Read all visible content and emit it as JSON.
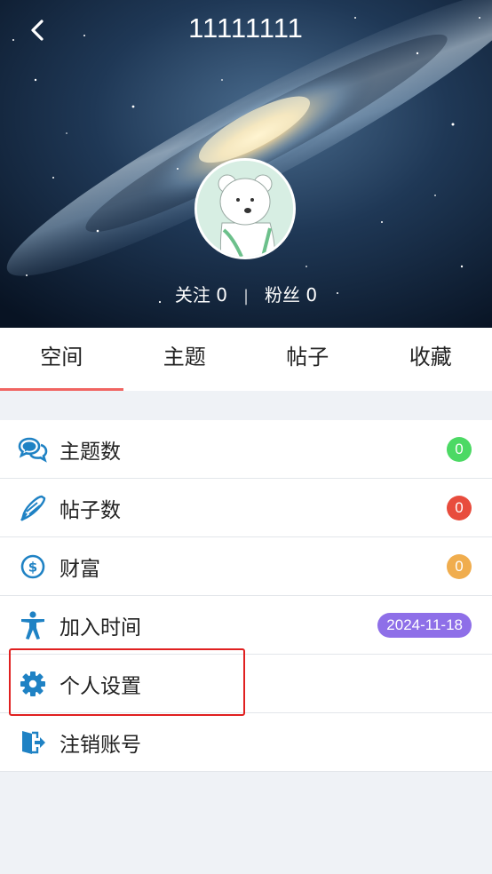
{
  "header": {
    "title": "11111111",
    "follow_label": "关注 0",
    "separator": "|",
    "fans_label": "粉丝 0"
  },
  "tabs": [
    {
      "label": "空间",
      "active": true
    },
    {
      "label": "主题",
      "active": false
    },
    {
      "label": "帖子",
      "active": false
    },
    {
      "label": "收藏",
      "active": false
    }
  ],
  "stats": [
    {
      "icon": "comments-icon",
      "label": "主题数",
      "badge": "0",
      "badge_color": "#4cd964"
    },
    {
      "icon": "pen-icon",
      "label": "帖子数",
      "badge": "0",
      "badge_color": "#e84c3d"
    },
    {
      "icon": "dollar-circle-icon",
      "label": "财富",
      "badge": "0",
      "badge_color": "#f0ad4e"
    },
    {
      "icon": "person-icon",
      "label": "加入时间",
      "badge": "2024-11-18",
      "badge_color": "#8e6fe8"
    },
    {
      "icon": "gear-icon",
      "label": "个人设置"
    },
    {
      "icon": "sign-out-icon",
      "label": "注销账号"
    }
  ],
  "colors": {
    "accent": "#f06461",
    "icon_blue": "#1f82c4",
    "highlight": "#e02020",
    "background": "#eff2f6"
  }
}
